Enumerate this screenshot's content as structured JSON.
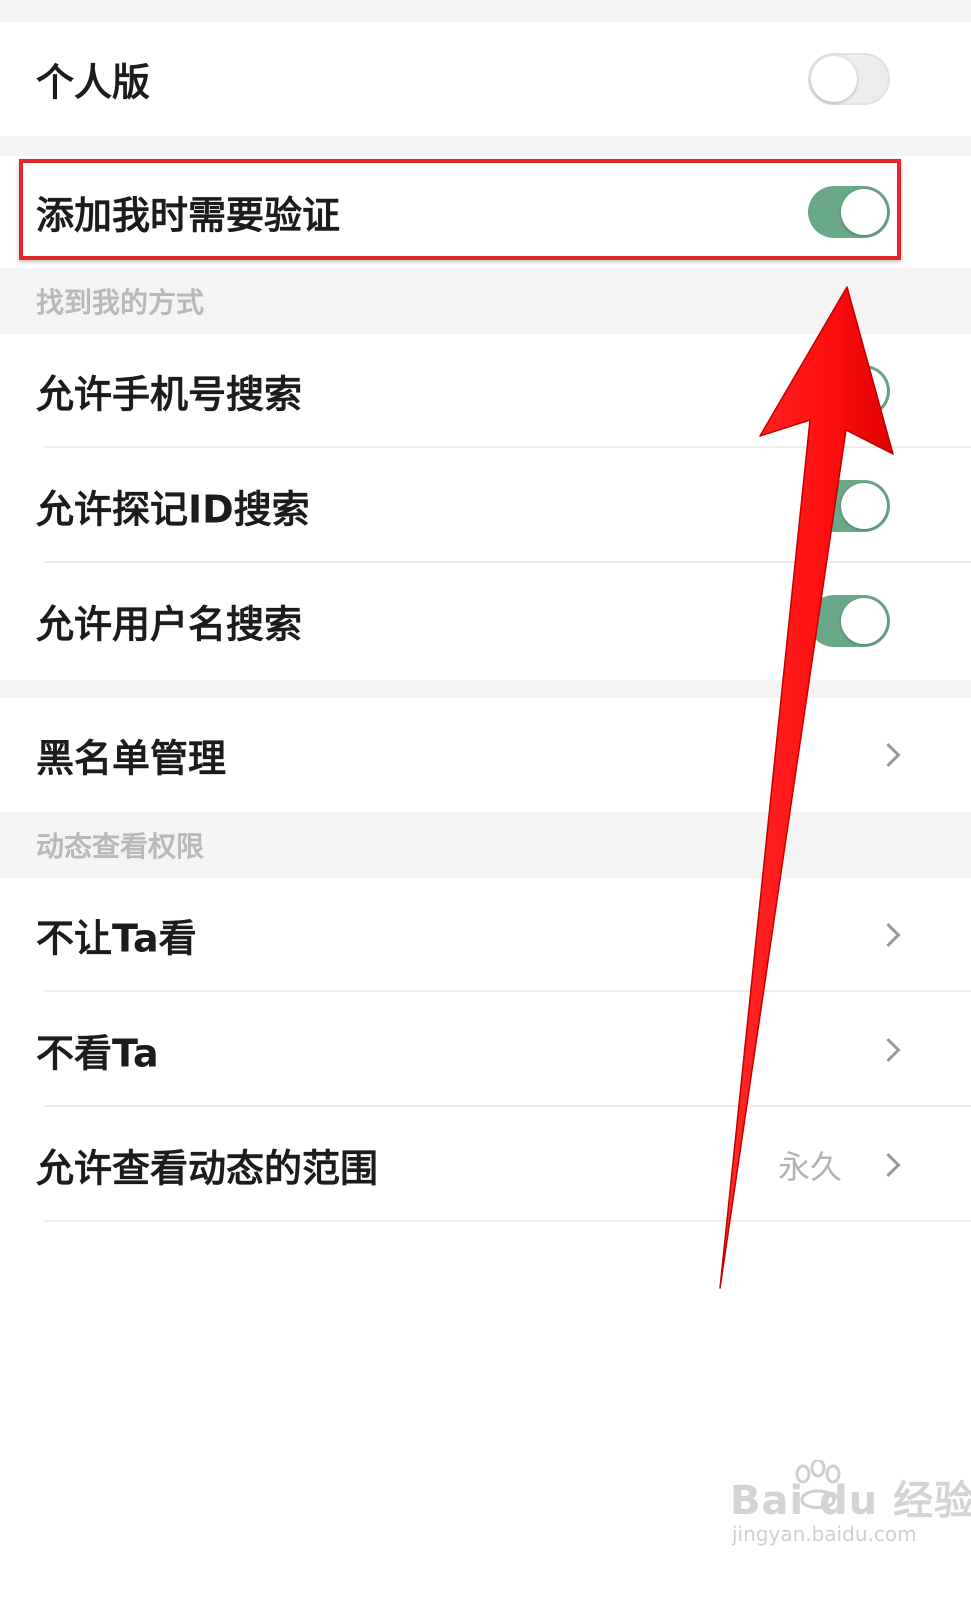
{
  "settings": {
    "personal": {
      "label": "个人版",
      "enabled": false
    },
    "verify": {
      "label": "添加我时需要验证",
      "enabled": true
    }
  },
  "find_me": {
    "header": "找到我的方式",
    "items": [
      {
        "label": "允许手机号搜索",
        "enabled": true
      },
      {
        "label": "允许探记ID搜索",
        "enabled": true
      },
      {
        "label": "允许用户名搜索",
        "enabled": true
      }
    ]
  },
  "blacklist": {
    "label": "黑名单管理"
  },
  "moments": {
    "header": "动态查看权限",
    "items": [
      {
        "label": "不让Ta看",
        "value": ""
      },
      {
        "label": "不看Ta",
        "value": ""
      },
      {
        "label": "允许查看动态的范围",
        "value": "永久"
      }
    ]
  },
  "annotation": {
    "highlight_color": "#e3262b",
    "arrow_color": "#ff1a1a"
  },
  "colors": {
    "toggle_on": "#6aa88a",
    "toggle_off": "#ececec",
    "section_bg": "#f4f4f4",
    "section_text": "#b9b9b9"
  },
  "watermark": {
    "main": "Bai du 经验",
    "sub": "jingyan.baidu.com"
  }
}
